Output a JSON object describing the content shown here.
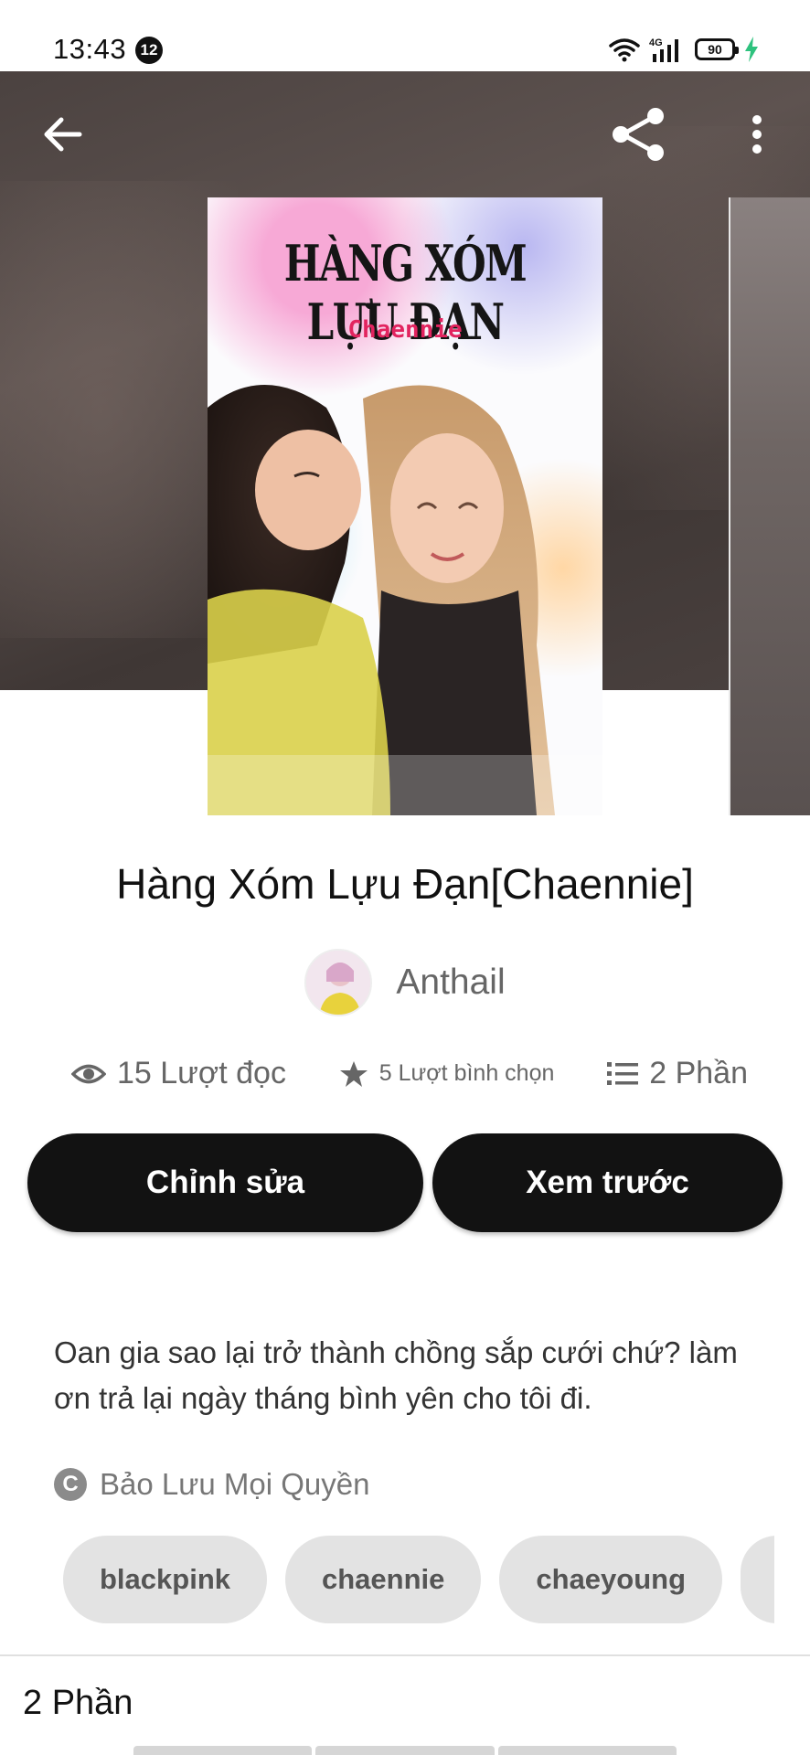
{
  "status_bar": {
    "time": "13:43",
    "notification_count": "12",
    "network": "4G",
    "battery": "90"
  },
  "toolbar": {
    "back_icon": "arrow-left-icon",
    "share_icon": "share-icon",
    "more_icon": "more-vertical-icon"
  },
  "cover": {
    "title": "HÀNG XÓM LỰU ĐẠN",
    "subtitle": "Chaennie"
  },
  "story": {
    "title": "Hàng Xóm Lựu Đạn[Chaennie]",
    "author": "Anthail",
    "stats": {
      "reads": "15 Lượt đọc",
      "votes": "5 Lượt bình chọn",
      "parts": "2 Phần"
    },
    "description": "Oan gia sao lại trở thành chồng sắp cưới chứ? làm ơn trả lại ngày tháng bình yên cho tôi đi.",
    "copyright": "Bảo Lưu Mọi Quyền",
    "tags": [
      "blackpink",
      "chaennie",
      "chaeyoung"
    ]
  },
  "actions": {
    "edit_label": "Chỉnh sửa",
    "preview_label": "Xem trước"
  },
  "parts_section": {
    "heading": "2 Phần"
  },
  "colors": {
    "button_bg": "#121212",
    "tag_bg": "#e3e3e3",
    "muted_text": "#666666"
  }
}
